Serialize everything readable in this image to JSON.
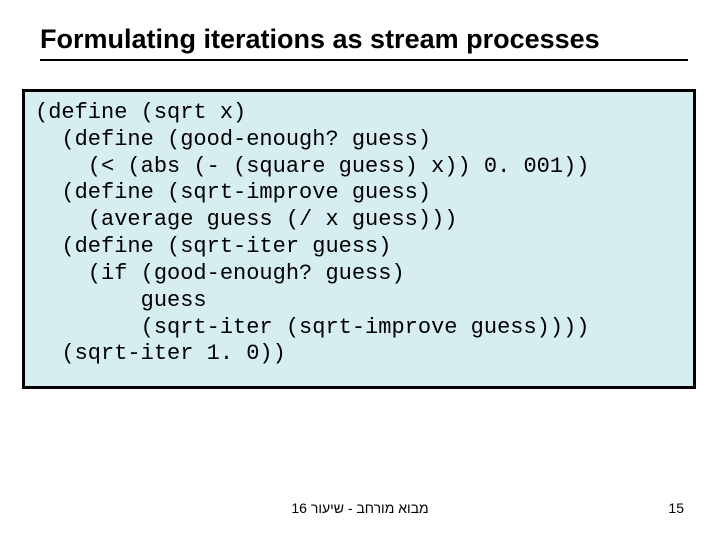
{
  "title": "Formulating iterations as stream processes",
  "code_lines": [
    "(define (sqrt x)",
    "  (define (good-enough? guess)",
    "    (< (abs (- (square guess) x)) 0. 001))",
    "  (define (sqrt-improve guess)",
    "    (average guess (/ x guess)))",
    "  (define (sqrt-iter guess)",
    "    (if (good-enough? guess)",
    "        guess",
    "        (sqrt-iter (sqrt-improve guess))))",
    "  (sqrt-iter 1. 0))"
  ],
  "footer_center": "מבוא מורחב - שיעור 16",
  "page_number": "15"
}
